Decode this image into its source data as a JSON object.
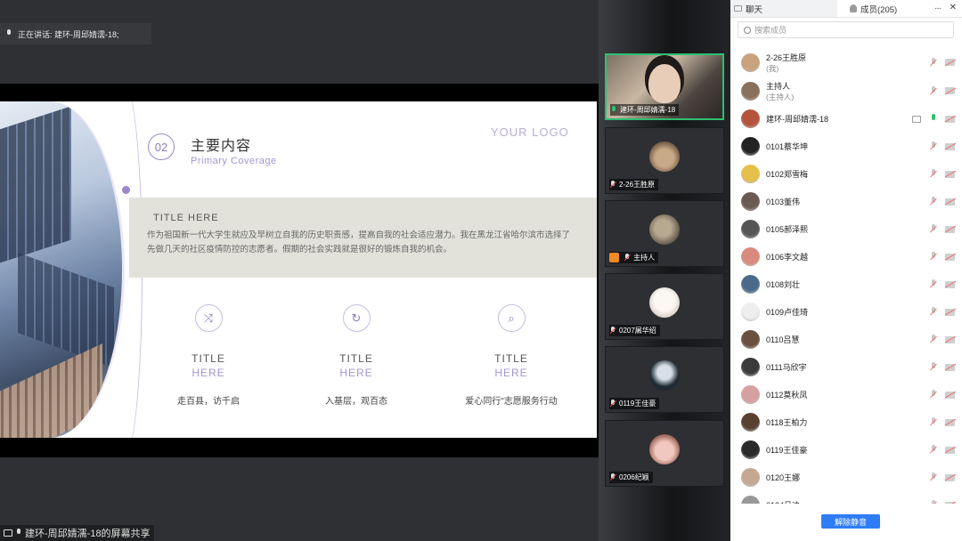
{
  "stage": {
    "speaking_text": "正在讲话: 建环-周邱婧濡-18;",
    "share_label": "建环-周邱婧濡-18的屏幕共享"
  },
  "slide": {
    "number": "02",
    "title": "主要内容",
    "subtitle": "Primary Coverage",
    "logo": "YOUR LOGO",
    "band_title": "TITLE HERE",
    "band_body": "作为祖国新一代大学生就应及早树立自我的历史职责感，提高自我的社会适应潜力。我在黑龙江省哈尔滨市选择了先做几天的社区疫情防控的志愿者。假期的社会实践就是很好的锻炼自我的机会。",
    "features": [
      {
        "icon": "shuffle-icon",
        "glyph": "⤨",
        "t1": "TITLE",
        "t2": "HERE",
        "desc": "走百县，访千启"
      },
      {
        "icon": "refresh-icon",
        "glyph": "↻",
        "t1": "TITLE",
        "t2": "HERE",
        "desc": "入基层，观百态"
      },
      {
        "icon": "search-icon",
        "glyph": "⌕",
        "t1": "TITLE",
        "t2": "HERE",
        "desc": "爱心同行\"志愿服务行动"
      }
    ]
  },
  "videos": [
    {
      "name": "建环-周邱婧濡-18",
      "active": true
    },
    {
      "name": "2-26王胜原",
      "active": false
    },
    {
      "name": "主持人",
      "active": false,
      "host": true
    },
    {
      "name": "0207屠华绍",
      "active": false
    },
    {
      "name": "0119王佳豪",
      "active": false
    },
    {
      "name": "0206纪颖",
      "active": false
    }
  ],
  "panel": {
    "tab_chat": "聊天",
    "tab_members": "成员(205)",
    "more": "···",
    "close": "✕",
    "search_placeholder": "搜索成员",
    "members": [
      {
        "name": "2-26王胜原",
        "sub": "(我)"
      },
      {
        "name": "主持人",
        "sub": "(主持人)"
      },
      {
        "name": "建环-周邱婧濡-18",
        "sub": "",
        "speaking": true
      },
      {
        "name": "0101蔡华坤",
        "sub": ""
      },
      {
        "name": "0102郑雪梅",
        "sub": ""
      },
      {
        "name": "0103董伟",
        "sub": ""
      },
      {
        "name": "0105郝泽熙",
        "sub": ""
      },
      {
        "name": "0106李文越",
        "sub": ""
      },
      {
        "name": "0108刘壮",
        "sub": ""
      },
      {
        "name": "0109卢佳琦",
        "sub": ""
      },
      {
        "name": "0110吕慧",
        "sub": ""
      },
      {
        "name": "0111马欣宇",
        "sub": ""
      },
      {
        "name": "0112莫秋凤",
        "sub": ""
      },
      {
        "name": "0118王柏力",
        "sub": ""
      },
      {
        "name": "0119王佳豪",
        "sub": ""
      },
      {
        "name": "0120王娜",
        "sub": ""
      },
      {
        "name": "0124吕迪",
        "sub": ""
      }
    ],
    "unmute_label": "解除静音"
  },
  "colors": {
    "accent_purple": "#9b87c9",
    "active_green": "#2fbf71",
    "button_blue": "#2f7df6"
  }
}
